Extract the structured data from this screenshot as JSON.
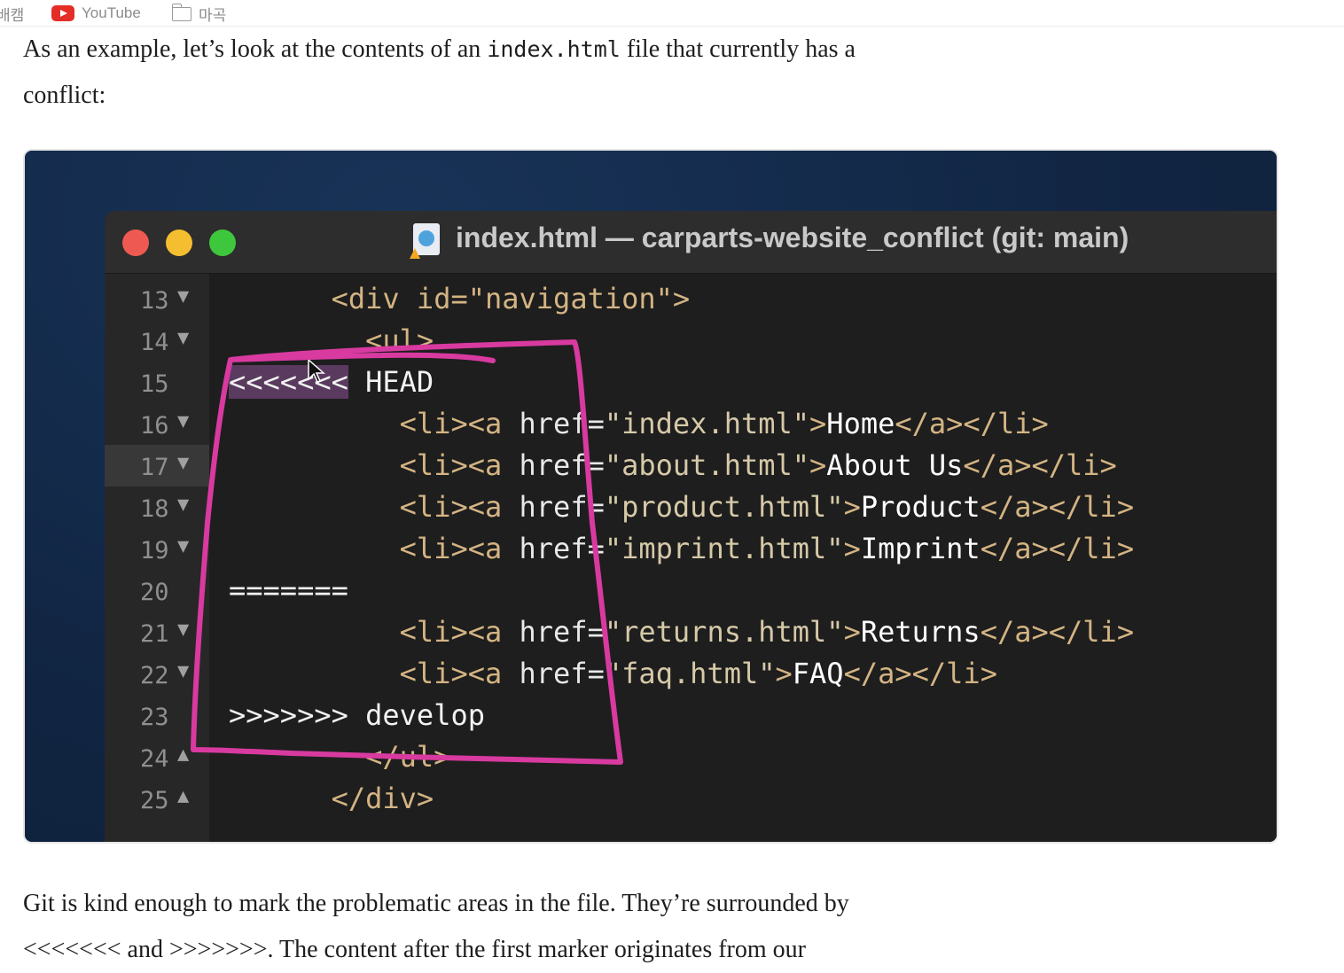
{
  "bookmarks": {
    "cut_label": "배캠",
    "youtube_label": "YouTube",
    "folder_label": "마곡"
  },
  "article": {
    "intro_before": "As an example, let’s look at the contents of an ",
    "intro_code": "index.html",
    "intro_after": " file that currently has a",
    "intro_line2": "conflict:",
    "outro_line1": "Git is kind enough to mark the problematic areas in the file. They’re surrounded by",
    "outro_line2": "<<<<<<< and >>>>>>>. The content after the first marker originates from our"
  },
  "editor": {
    "window_title": "index.html — carparts-website_conflict (git: main)",
    "lines": [
      {
        "num": "13",
        "fold": "▼"
      },
      {
        "num": "14",
        "fold": "▼"
      },
      {
        "num": "15",
        "fold": ""
      },
      {
        "num": "16",
        "fold": "▼"
      },
      {
        "num": "17",
        "fold": "▼"
      },
      {
        "num": "18",
        "fold": "▼"
      },
      {
        "num": "19",
        "fold": "▼"
      },
      {
        "num": "20",
        "fold": ""
      },
      {
        "num": "21",
        "fold": "▼"
      },
      {
        "num": "22",
        "fold": "▼"
      },
      {
        "num": "23",
        "fold": ""
      },
      {
        "num": "24",
        "fold": "▲"
      },
      {
        "num": "25",
        "fold": "▲"
      }
    ],
    "code": {
      "l13": "      <div id=\"navigation\">",
      "l14": "        <ul>",
      "l15_marker": "<<<<<<<",
      "l15_rest": " HEAD",
      "l16": {
        "pre": "          <li><a ",
        "attr": "href=",
        "val": "\"index.html\"",
        "gt": ">",
        "text": "Home",
        "close": "</a></li>"
      },
      "l17": {
        "pre": "          <li><a ",
        "attr": "href=",
        "val": "\"about.html\"",
        "gt": ">",
        "text": "About Us",
        "close": "</a></li>"
      },
      "l18": {
        "pre": "          <li><a ",
        "attr": "href=",
        "val": "\"product.html\"",
        "gt": ">",
        "text": "Product",
        "close": "</a></li>"
      },
      "l19": {
        "pre": "          <li><a ",
        "attr": "href=",
        "val": "\"imprint.html\"",
        "gt": ">",
        "text": "Imprint",
        "close": "</a></li>"
      },
      "l20": "=======",
      "l21": {
        "pre": "          <li><a ",
        "attr": "href=",
        "val": "\"returns.html\"",
        "gt": ">",
        "text": "Returns",
        "close": "</a></li>"
      },
      "l22": {
        "pre": "          <li><a ",
        "attr": "href=",
        "val": "\"faq.html\"",
        "gt": ">",
        "text": "FAQ",
        "close": "</a></li>"
      },
      "l23": ">>>>>>> develop",
      "l24": "        </ul>",
      "l25": "      </div>"
    }
  },
  "colors": {
    "annotation": "#d83aa0",
    "tag": "#d4b483"
  }
}
